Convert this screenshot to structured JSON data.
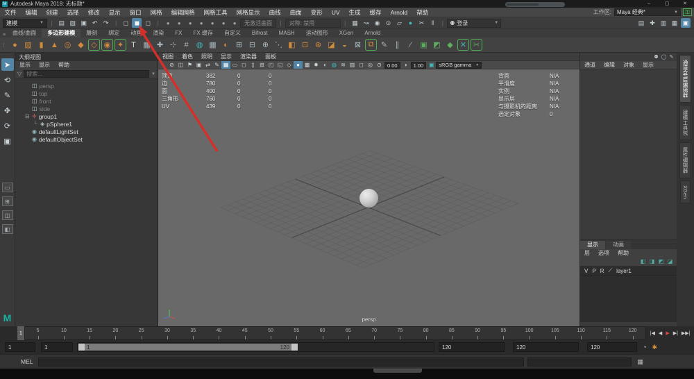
{
  "window": {
    "title": "Autodesk Maya 2018: 无标题*",
    "minimize": "–",
    "maximize": "▢",
    "close": "✕"
  },
  "menubar": {
    "items": [
      {
        "label": "文件"
      },
      {
        "label": "编辑"
      },
      {
        "label": "创建"
      },
      {
        "label": "选择"
      },
      {
        "label": "修改"
      },
      {
        "label": "显示"
      },
      {
        "label": "窗口"
      },
      {
        "label": "网格"
      },
      {
        "label": "编辑网格"
      },
      {
        "label": "网格工具"
      },
      {
        "label": "网格显示"
      },
      {
        "label": "曲线"
      },
      {
        "label": "曲面"
      },
      {
        "label": "变形"
      },
      {
        "label": "UV"
      },
      {
        "label": "生成"
      },
      {
        "label": "缓存"
      },
      {
        "label": "Arnold"
      },
      {
        "label": "帮助"
      }
    ],
    "workspace_label": "工作区:",
    "workspace_value": "Maya 经典*",
    "lock_icon": "🔒"
  },
  "statusline": {
    "mode": "建模",
    "file_icons": [
      {
        "n": "new-scene-icon",
        "g": "▤"
      },
      {
        "n": "open-scene-icon",
        "g": "▨"
      },
      {
        "n": "save-scene-icon",
        "g": "▣"
      },
      {
        "n": "undo-icon",
        "g": "↶"
      },
      {
        "n": "redo-icon",
        "g": "↷"
      }
    ],
    "selection_mode_icons": [
      {
        "n": "select-hierarchy-icon",
        "g": "◻"
      },
      {
        "n": "select-object-icon",
        "g": "◼",
        "cls": "on"
      },
      {
        "n": "select-component-icon",
        "g": "◻"
      }
    ],
    "selection_mask_icons": [
      {
        "n": "select-all-mask-icon",
        "g": "●"
      },
      {
        "n": "select-handles-mask-icon",
        "g": "●"
      },
      {
        "n": "select-joints-mask-icon",
        "g": "●"
      },
      {
        "n": "select-curves-mask-icon",
        "g": "●"
      },
      {
        "n": "select-surfaces-mask-icon",
        "g": "●"
      },
      {
        "n": "select-deformations-mask-icon",
        "g": "●"
      },
      {
        "n": "select-rendering-mask-icon",
        "g": "●"
      }
    ],
    "no_active_surface": "无激活曲面",
    "symmetry_label": "对称: 禁用",
    "snap_icons": [
      {
        "n": "snap-to-grids-icon",
        "g": "▦"
      },
      {
        "n": "snap-to-curves-icon",
        "g": "↝"
      },
      {
        "n": "snap-to-points-icon",
        "g": "◉"
      },
      {
        "n": "snap-to-projected-center-icon",
        "g": "⊙"
      },
      {
        "n": "snap-to-view-planes-icon",
        "g": "▱"
      },
      {
        "n": "make-live-icon",
        "g": "●",
        "cls": "teal"
      },
      {
        "n": "snap-together-icon",
        "g": "✂"
      },
      {
        "n": "pause-icon",
        "g": "‖"
      }
    ],
    "login_label": "登录",
    "login_icon": "⚉",
    "sidebar_toggle_icons": [
      {
        "n": "attribute-editor-toggle-icon",
        "g": "▤"
      },
      {
        "n": "tool-settings-toggle-icon",
        "g": "✚"
      },
      {
        "n": "channel-box-toggle-icon",
        "g": "▥"
      },
      {
        "n": "modeling-toolkit-toggle-icon",
        "g": "▦"
      },
      {
        "n": "sidebar-active-toggle-icon",
        "g": "▣",
        "cls": "on"
      }
    ]
  },
  "shelf": {
    "tabs": [
      {
        "label": "曲线/曲面"
      },
      {
        "label": "多边形建模",
        "cls": "active"
      },
      {
        "label": "雕刻"
      },
      {
        "label": "绑定"
      },
      {
        "label": "动画"
      },
      {
        "label": "渲染"
      },
      {
        "label": "FX"
      },
      {
        "label": "FX 缓存"
      },
      {
        "label": "自定义"
      },
      {
        "label": "Bifrost"
      },
      {
        "label": "MASH"
      },
      {
        "label": "运动图形"
      },
      {
        "label": "XGen"
      },
      {
        "label": "Arnold"
      }
    ],
    "icons": [
      {
        "n": "poly-sphere-icon",
        "c": "#cf8a3e",
        "g": "●"
      },
      {
        "n": "poly-cube-icon",
        "c": "#cf8a3e",
        "g": "▧"
      },
      {
        "n": "poly-cylinder-icon",
        "c": "#cf8a3e",
        "g": "▮"
      },
      {
        "n": "poly-cone-icon",
        "c": "#cf8a3e",
        "g": "▲"
      },
      {
        "n": "poly-torus-icon",
        "c": "#cf8a3e",
        "g": "◎"
      },
      {
        "n": "poly-plane-icon",
        "c": "#cf8a3e",
        "g": "◆"
      },
      {
        "n": "poly-disc-icon",
        "c": "#cf8a3e",
        "g": "◇",
        "cls": "br"
      },
      {
        "n": "platonic-solid-icon",
        "c": "#cf8a3e",
        "g": "◉",
        "cls": "br"
      },
      {
        "n": "super-shapes-icon",
        "c": "#cf8a3e",
        "g": "✦",
        "cls": "br"
      },
      {
        "n": "type-tool-icon",
        "c": "#d8dadb",
        "g": "T"
      },
      {
        "n": "svg-tool-icon",
        "c": "#a8b6bc",
        "g": "▦"
      },
      {
        "n": "sculpt-tool-icon",
        "c": "#a8b6bc",
        "g": "✚"
      },
      {
        "n": "measure-tool-icon",
        "c": "#a8b6bc",
        "g": "⊹"
      },
      {
        "n": "poly-count-icon",
        "c": "#a8b6bc",
        "g": "#"
      },
      {
        "n": "make-live-shelf-icon",
        "c": "#43b5b5",
        "g": "◍"
      },
      {
        "n": "grid-snap-shelf-icon",
        "c": "#a8b6bc",
        "g": "▦"
      },
      {
        "n": "boolean-union-icon",
        "c": "#cf8a3e",
        "g": "◐"
      },
      {
        "n": "combine-icon",
        "c": "#a8b6bc",
        "g": "⊞"
      },
      {
        "n": "separate-icon",
        "c": "#a8b6bc",
        "g": "⊟"
      },
      {
        "n": "smooth-icon",
        "c": "#a8b6bc",
        "g": "⊕"
      },
      {
        "n": "reduce-icon",
        "c": "#a8b6bc",
        "g": "⋱"
      },
      {
        "n": "mirror-icon",
        "c": "#cf8a3e",
        "g": "◧"
      },
      {
        "n": "extrude-icon",
        "c": "#cf8a3e",
        "g": "⊡"
      },
      {
        "n": "bevel-icon",
        "c": "#cf8a3e",
        "g": "⊛"
      },
      {
        "n": "bridge-icon",
        "c": "#cf8a3e",
        "g": "◪"
      },
      {
        "n": "fill-hole-icon",
        "c": "#cf8a3e",
        "g": "◒"
      },
      {
        "n": "append-polygon-icon",
        "c": "#a8b6bc",
        "g": "⊠"
      },
      {
        "n": "duplicate-face-icon",
        "c": "#cf8a3e",
        "g": "⧉",
        "cls": "br"
      },
      {
        "n": "multi-cut-icon",
        "c": "#a8b6bc",
        "g": "✎"
      },
      {
        "n": "insert-edge-loop-icon",
        "c": "#a8b6bc",
        "g": "∥"
      },
      {
        "n": "offset-edge-loop-icon",
        "c": "#a8b6bc",
        "g": "⁄"
      },
      {
        "n": "target-weld-icon",
        "c": "#5fae5f",
        "g": "▣"
      },
      {
        "n": "quad-draw-icon",
        "c": "#5fae5f",
        "g": "◩"
      },
      {
        "n": "symmetrize-icon",
        "c": "#5fae5f",
        "g": "◆"
      },
      {
        "n": "delete-edge-icon",
        "c": "#43b5b5",
        "g": "✕",
        "cls": "br"
      },
      {
        "n": "slide-edge-icon",
        "c": "#5fae5f",
        "g": "✂",
        "cls": "br"
      }
    ]
  },
  "toolbox": {
    "tools": [
      {
        "n": "select-tool-icon",
        "g": "➤",
        "cls": "active"
      },
      {
        "n": "lasso-tool-icon",
        "g": "⟲"
      },
      {
        "n": "paint-select-tool-icon",
        "g": "✎"
      },
      {
        "n": "move-tool-icon",
        "g": "✥"
      },
      {
        "n": "rotate-tool-icon",
        "g": "⟳"
      },
      {
        "n": "scale-tool-icon",
        "g": "▣"
      }
    ],
    "layouts": [
      {
        "n": "single-pane-layout-icon",
        "g": "▭"
      },
      {
        "n": "four-pane-layout-icon",
        "g": "⊞"
      },
      {
        "n": "two-pane-layout-icon",
        "g": "◫"
      },
      {
        "n": "outliner-pane-layout-icon",
        "g": "◧"
      }
    ],
    "maya_logo": "M"
  },
  "outliner": {
    "title": "大纲视图",
    "menus": [
      {
        "label": "显示"
      },
      {
        "label": "显示"
      },
      {
        "label": "帮助"
      }
    ],
    "search_placeholder": "搜索...",
    "items": [
      {
        "n": "outliner-item-persp",
        "label": "persp",
        "icon": "◫",
        "cls": "dim"
      },
      {
        "n": "outliner-item-top",
        "label": "top",
        "icon": "◫",
        "cls": "dim"
      },
      {
        "n": "outliner-item-front",
        "label": "front",
        "icon": "◫",
        "cls": "dim"
      },
      {
        "n": "outliner-item-side",
        "label": "side",
        "icon": "◫",
        "cls": "dim"
      },
      {
        "n": "outliner-item-group1",
        "label": "group1",
        "icon": "✛",
        "pre": "⊟",
        "cls": "grp"
      },
      {
        "n": "outliner-item-psphere1",
        "label": "pSphere1",
        "icon": "◈",
        "pre": "└",
        "cls": "child"
      },
      {
        "n": "outliner-item-defaultlightset",
        "label": "defaultLightSet",
        "icon": "◉",
        "cls": "set"
      },
      {
        "n": "outliner-item-defaultobjectset",
        "label": "defaultObjectSet",
        "icon": "◉",
        "cls": "set"
      }
    ]
  },
  "viewport": {
    "menus": [
      {
        "label": "视图"
      },
      {
        "label": "着色"
      },
      {
        "label": "照明"
      },
      {
        "label": "显示"
      },
      {
        "label": "渲染器"
      },
      {
        "label": "面板"
      }
    ],
    "toolbar_icons": [
      {
        "n": "select-camera-icon",
        "g": "⌖"
      },
      {
        "n": "lock-camera-icon",
        "g": "⊘"
      },
      {
        "n": "camera-attributes-icon",
        "g": "◫"
      },
      {
        "n": "bookmark-icon",
        "g": "⚑"
      },
      {
        "n": "image-plane-icon",
        "g": "▣"
      },
      {
        "n": "pan-zoom-icon",
        "g": "⇄"
      },
      {
        "n": "grease-pencil-icon",
        "g": "✎"
      },
      {
        "n": "grid-toggle-icon",
        "g": "▦",
        "cls": "on"
      },
      {
        "n": "film-gate-icon",
        "g": "▭"
      },
      {
        "n": "resolution-gate-icon",
        "g": "◻"
      },
      {
        "n": "gate-mask-icon",
        "g": "▯"
      },
      {
        "n": "field-chart-icon",
        "g": "⊞"
      },
      {
        "n": "safe-action-icon",
        "g": "◰"
      },
      {
        "n": "safe-title-icon",
        "g": "◱"
      },
      {
        "n": "wireframe-icon",
        "g": "◇"
      },
      {
        "n": "shaded-mode-icon",
        "g": "●",
        "cls": "on"
      },
      {
        "n": "textured-mode-icon",
        "g": "▩"
      },
      {
        "n": "lights-icon",
        "g": "✹"
      },
      {
        "n": "shadows-icon",
        "g": "◐"
      },
      {
        "n": "ambient-occlusion-icon",
        "g": "◍",
        "cls": "teal"
      },
      {
        "n": "motion-blur-icon",
        "g": "≋"
      },
      {
        "n": "multisample-icon",
        "g": "▥"
      },
      {
        "n": "xray-icon",
        "g": "◻"
      },
      {
        "n": "isolate-select-icon",
        "g": "◎"
      }
    ],
    "exposure_icon": "⊙",
    "exposure": "0.00",
    "gamma_icon": "◑",
    "gamma": "1.00",
    "colorspace": "sRGB gamma",
    "stats_left": [
      [
        "顶点",
        "382",
        "0",
        "0"
      ],
      [
        "边",
        "780",
        "0",
        "0"
      ],
      [
        "面",
        "400",
        "0",
        "0"
      ],
      [
        "三角形",
        "760",
        "0",
        "0"
      ],
      [
        "UV",
        "439",
        "0",
        "0"
      ]
    ],
    "stats_right": [
      [
        "背面",
        "N/A"
      ],
      [
        "平滑度",
        "N/A"
      ],
      [
        "实例",
        "N/A"
      ],
      [
        "显示层",
        "N/A"
      ],
      [
        "与摄影机的距离",
        "N/A"
      ],
      [
        "选定对象",
        "0"
      ]
    ],
    "camera_label": "persp"
  },
  "channelbox": {
    "menus": [
      {
        "label": "通道"
      },
      {
        "label": "编辑"
      },
      {
        "label": "对象"
      },
      {
        "label": "显示"
      }
    ],
    "corner_icons": [
      {
        "n": "show-manipulators-icon",
        "g": "⚉"
      },
      {
        "n": "speed-state-icon",
        "g": "◯"
      },
      {
        "n": "hyperbuild-icon",
        "g": "✎"
      }
    ]
  },
  "layers": {
    "tabs": [
      {
        "label": "显示",
        "cls": "active"
      },
      {
        "label": "动画"
      }
    ],
    "menus": [
      {
        "label": "层"
      },
      {
        "label": "选项"
      },
      {
        "label": "帮助"
      }
    ],
    "toolbar_icons": [
      {
        "n": "move-layer-up-icon",
        "g": "◧"
      },
      {
        "n": "move-layer-down-icon",
        "g": "◨"
      },
      {
        "n": "new-empty-layer-icon",
        "g": "◩"
      },
      {
        "n": "new-layer-from-selected-icon",
        "g": "◪"
      }
    ],
    "rows": [
      {
        "n": "layer-row-layer1",
        "v": "V",
        "p": "P",
        "r": "R",
        "type": "⟋",
        "name": "layer1"
      }
    ]
  },
  "side_tabs": [
    {
      "label": "通道盒/层编辑器",
      "cls": "active"
    },
    {
      "label": "建模工具包"
    },
    {
      "label": "属性编辑器"
    },
    {
      "label": "XGen"
    }
  ],
  "timeline": {
    "ticks": [
      5,
      10,
      15,
      20,
      25,
      30,
      35,
      40,
      45,
      50,
      55,
      60,
      65,
      70,
      75,
      80,
      85,
      90,
      95,
      100,
      105,
      110,
      115,
      120
    ],
    "current": "1",
    "playback_icons": [
      {
        "n": "step-back-frame-icon",
        "g": "|◀"
      },
      {
        "n": "play-backward-icon",
        "g": "◀"
      },
      {
        "n": "play-forward-icon",
        "g": "▶",
        "cls": "red"
      },
      {
        "n": "step-forward-frame-icon",
        "g": "▶|"
      },
      {
        "n": "go-to-end-icon",
        "g": "▶▶|"
      }
    ]
  },
  "range": {
    "playback_start": "1",
    "anim_start": "1",
    "bar_start": "1",
    "bar_end": "120",
    "anim_end": "120",
    "playback_end": "120",
    "extra_end": "120",
    "icons": [
      {
        "n": "anim-preferences-icon",
        "g": "◔"
      },
      {
        "n": "auto-key-icon",
        "g": "✱",
        "cls": "orange"
      }
    ]
  },
  "command": {
    "label": "MEL"
  },
  "colors": {
    "accent_blue": "#5285a6",
    "shelf_orange": "#cf8a3e",
    "annotation_red": "#d4302a",
    "make_live_teal": "#45b8b8",
    "viewport_gray": "#696969"
  }
}
